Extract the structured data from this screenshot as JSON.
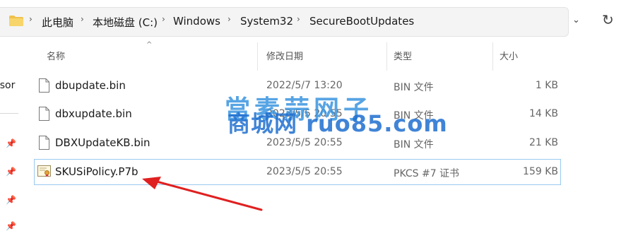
{
  "breadcrumb": {
    "items": [
      "此电脑",
      "本地磁盘 (C:)",
      "Windows",
      "System32",
      "SecureBootUpdates"
    ]
  },
  "left_pane": {
    "partial_text": "rsor"
  },
  "columns": {
    "name": "名称",
    "modified": "修改日期",
    "type": "类型",
    "size": "大小"
  },
  "files": [
    {
      "name": "dbupdate.bin",
      "modified": "2022/5/7 13:20",
      "type": "BIN 文件",
      "size": "1 KB",
      "icon": "file-icon"
    },
    {
      "name": "dbxupdate.bin",
      "modified": "2023/5/5 20:55",
      "type": "BIN 文件",
      "size": "14 KB",
      "icon": "file-icon"
    },
    {
      "name": "DBXUpdateKB.bin",
      "modified": "2023/5/5 20:55",
      "type": "BIN 文件",
      "size": "21 KB",
      "icon": "file-icon"
    },
    {
      "name": "SKUSiPolicy.P7b",
      "modified": "2023/5/5 20:55",
      "type": "PKCS #7 证书",
      "size": "159 KB",
      "icon": "certificate-icon"
    }
  ],
  "watermark": {
    "line1": "當素蒜网子",
    "line2": "商城网 ruo85.com"
  },
  "colors": {
    "accent": "#99c9ef",
    "arrow": "#e02020",
    "folder": "#f0c14b"
  }
}
